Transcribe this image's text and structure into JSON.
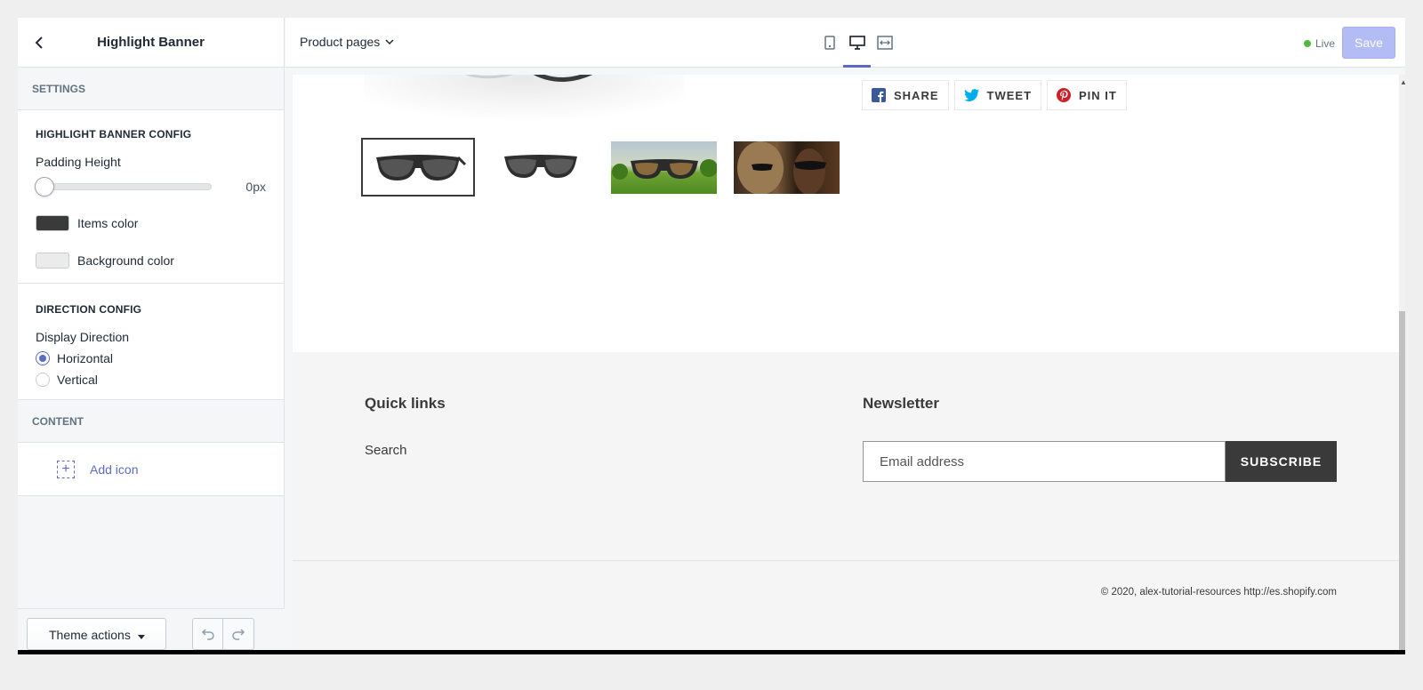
{
  "sidebar": {
    "title": "Highlight Banner",
    "settings_label": "SETTINGS",
    "highlight_config": {
      "heading": "HIGHLIGHT BANNER CONFIG",
      "padding_label": "Padding Height",
      "padding_value": "0px",
      "padding_level": 0,
      "items_color_label": "Items color",
      "items_color": "#3a3a3a",
      "background_color_label": "Background color",
      "background_color": "#ebebeb"
    },
    "direction_config": {
      "heading": "DIRECTION CONFIG",
      "label": "Display Direction",
      "options": [
        "Horizontal",
        "Vertical"
      ],
      "selected": "Horizontal"
    },
    "content_label": "CONTENT",
    "add_icon_label": "Add icon",
    "theme_actions_label": "Theme actions"
  },
  "topbar": {
    "page_select": "Product pages",
    "devices": [
      "mobile-icon",
      "desktop-icon",
      "fullscreen-icon"
    ],
    "active_device": "desktop-icon",
    "status": "Live",
    "save_label": "Save",
    "accent": "#5c6ac4"
  },
  "preview": {
    "share_buttons": [
      {
        "label": "SHARE",
        "icon": "facebook-icon",
        "color": "#3b5998"
      },
      {
        "label": "TWEET",
        "icon": "twitter-icon",
        "color": "#00aced"
      },
      {
        "label": "PIN IT",
        "icon": "pinterest-icon",
        "color": "#cb2027"
      }
    ],
    "footer": {
      "quick_links_heading": "Quick links",
      "links": [
        "Search"
      ],
      "newsletter_heading": "Newsletter",
      "email_placeholder": "Email address",
      "subscribe_label": "SUBSCRIBE",
      "copyright": "© 2020, alex-tutorial-resources http://es.shopify.com"
    }
  }
}
